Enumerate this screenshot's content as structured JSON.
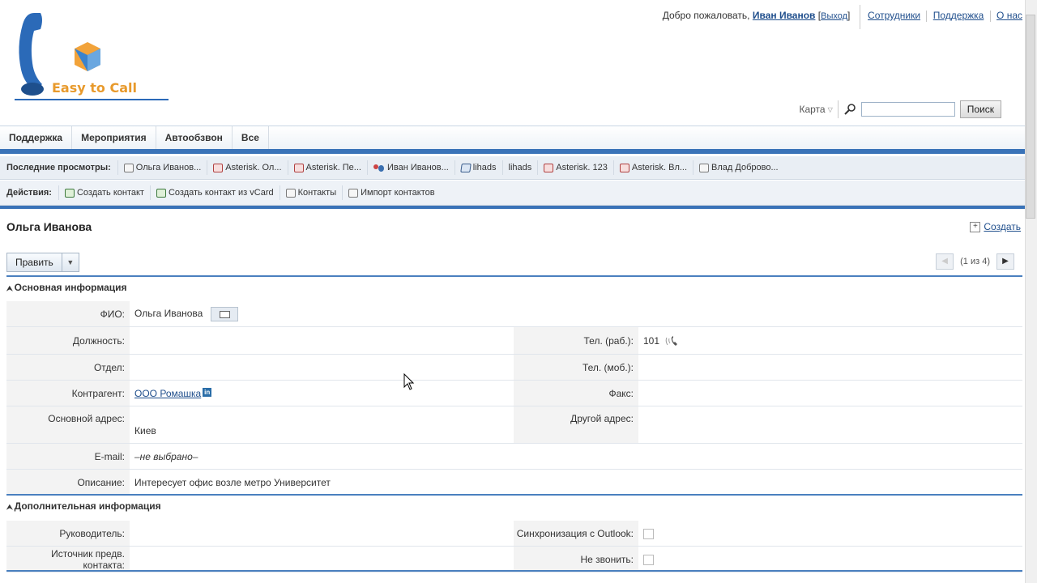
{
  "header": {
    "logo_text": "Easy to Call",
    "welcome": "Добро пожаловать,",
    "user_name": "Иван Иванов",
    "exit_label": "Выход",
    "links": [
      "Сотрудники",
      "Поддержка",
      "О нас"
    ],
    "map_label": "Карта",
    "search_placeholder": "",
    "search_button": "Поиск"
  },
  "nav": {
    "tabs": [
      "Поддержка",
      "Мероприятия",
      "Автообзвон",
      "Все"
    ]
  },
  "recent": {
    "label": "Последние просмотры:",
    "items": [
      {
        "text": "Ольга Иванов...",
        "icon": "contact-icon"
      },
      {
        "text": "Asterisk. Ол...",
        "icon": "call-icon"
      },
      {
        "text": "Asterisk. Пе...",
        "icon": "call-icon"
      },
      {
        "text": "Иван Иванов...",
        "icon": "users-icon"
      },
      {
        "text": "lihads",
        "icon": "book-icon"
      },
      {
        "text": "lihads",
        "icon": "none"
      },
      {
        "text": "Asterisk. 123",
        "icon": "call-icon"
      },
      {
        "text": "Asterisk. Вл...",
        "icon": "call-icon"
      },
      {
        "text": "Влад Доброво...",
        "icon": "contact-icon"
      }
    ]
  },
  "actions": {
    "label": "Действия:",
    "items": [
      "Создать контакт",
      "Создать контакт из vCard",
      "Контакты",
      "Импорт контактов"
    ]
  },
  "page": {
    "title": "Ольга Иванова",
    "create_label": "Создать",
    "edit_label": "Править",
    "pager_text": "(1 из 4)"
  },
  "main_section": {
    "title": "Основная информация",
    "fio_label": "ФИО:",
    "fio_value": "Ольга Иванова",
    "position_label": "Должность:",
    "position_value": "",
    "work_phone_label": "Тел. (раб.):",
    "work_phone_value": "101",
    "dept_label": "Отдел:",
    "dept_value": "",
    "mobile_label": "Тел. (моб.):",
    "mobile_value": "",
    "counterparty_label": "Контрагент:",
    "counterparty_value": "ООО Ромашка",
    "fax_label": "Факс:",
    "fax_value": "",
    "address_label": "Основной адрес:",
    "address_value": "Киев",
    "other_address_label": "Другой адрес:",
    "other_address_value": "",
    "email_label": "E-mail:",
    "email_value": "–не выбрано–",
    "description_label": "Описание:",
    "description_value": "Интересует офис возле метро Университет"
  },
  "extra_section": {
    "title": "Дополнительная информация",
    "manager_label": "Руководитель:",
    "manager_value": "",
    "outlook_label": "Синхронизация с Outlook:",
    "outlook_checked": false,
    "source_label": "Источник предв. контакта:",
    "source_value": "",
    "no_call_label": "Не звонить:",
    "no_call_checked": false
  },
  "colors": {
    "accent": "#3a73b8",
    "link": "#1f4e8c",
    "label_bg": "#f3f3f3"
  }
}
